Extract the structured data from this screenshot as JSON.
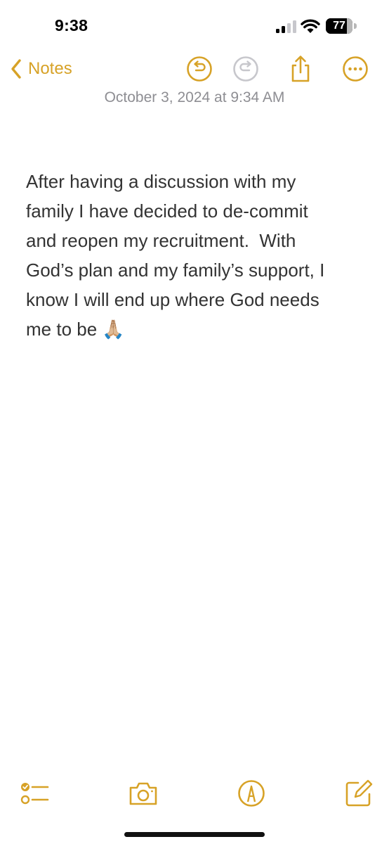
{
  "status_bar": {
    "time": "9:38",
    "battery_percent": "77",
    "icons": [
      "cellular-signal-icon",
      "wifi-icon",
      "battery-icon"
    ]
  },
  "nav": {
    "back_label": "Notes",
    "icons": [
      "chevron-left-icon",
      "undo-icon",
      "redo-icon",
      "share-icon",
      "more-icon"
    ]
  },
  "note": {
    "date": "October 3, 2024 at 9:34 AM",
    "lines": [
      "After having a discussion with my",
      "family I have decided to de-commit",
      "and reopen my recruitment.  With",
      "God’s plan and my family’s support, I",
      "know I will end up where God needs",
      "me to be 🙏🏼"
    ]
  },
  "toolbar": {
    "icons": [
      "checklist-icon",
      "camera-icon",
      "markup-icon",
      "compose-icon"
    ]
  },
  "colors": {
    "accent": "#D7A227",
    "date_text": "#8e8e93",
    "body_text": "#333333",
    "disabled_icon": "#c7c7cc"
  }
}
